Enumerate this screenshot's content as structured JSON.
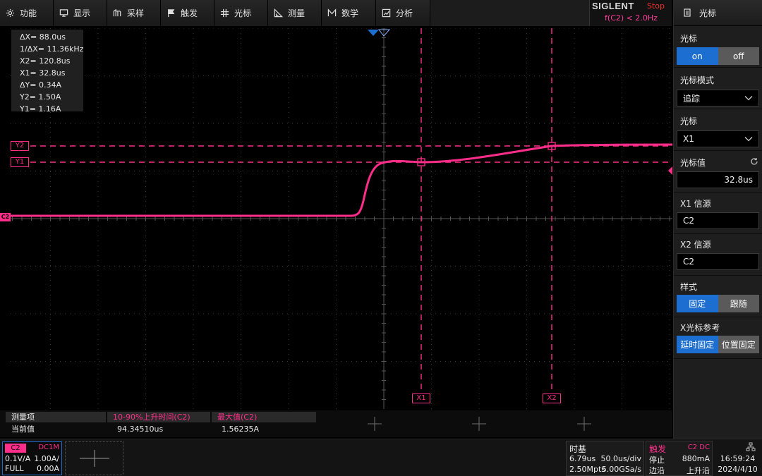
{
  "menu": [
    {
      "label": "功能",
      "icon": "gear-icon"
    },
    {
      "label": "显示",
      "icon": "monitor-icon"
    },
    {
      "label": "采样",
      "icon": "acquire-icon"
    },
    {
      "label": "触发",
      "icon": "trigger-flag-icon"
    },
    {
      "label": "光标",
      "icon": "cursor-cross-icon"
    },
    {
      "label": "测量",
      "icon": "ruler-icon"
    },
    {
      "label": "数学",
      "icon": "math-icon"
    },
    {
      "label": "分析",
      "icon": "analysis-icon"
    }
  ],
  "brand": "SIGLENT",
  "run_state": "Stop",
  "freq_readout": "f(C2) < 2.0Hz",
  "cursor_readout": [
    "ΔX= 88.0us",
    "1/ΔX= 11.36kHz",
    "X2= 120.8us",
    "X1= 32.8us",
    "ΔY= 0.34A",
    "Y2= 1.50A",
    "Y1= 1.16A"
  ],
  "cursor_tags": {
    "y2": "Y2",
    "y1": "Y1",
    "x1": "X1",
    "x2": "X2"
  },
  "channel_marker": "C2",
  "waveform": {
    "color": "#ff2d8a",
    "channel": "C2"
  },
  "panel": {
    "title": "光标",
    "cursor_label": "光标",
    "cursor_on": "on",
    "cursor_off": "off",
    "mode_label": "光标模式",
    "mode_value": "追踪",
    "select_label": "光标",
    "select_value": "X1",
    "value_label": "光标值",
    "value": "32.8us",
    "x1_src_label": "X1 信源",
    "x1_src": "C2",
    "x2_src_label": "X2 信源",
    "x2_src": "C2",
    "style_label": "样式",
    "style_fixed": "固定",
    "style_follow": "跟随",
    "xref_label": "X光标参考",
    "xref_delay": "延时固定",
    "xref_pos": "位置固定"
  },
  "measure": {
    "header_label": "测量项",
    "row_label": "当前值",
    "items": [
      {
        "name": "10-90%上升时间(C2)",
        "value": "94.34510us"
      },
      {
        "name": "最大值(C2)",
        "value": "1.56235A"
      }
    ]
  },
  "channel2": {
    "tag": "C2",
    "coupling": "DC1M",
    "scale": "0.1V/A",
    "vdiv": "1.00A/",
    "bw": "FULL",
    "offset": "0.00A"
  },
  "timebase": {
    "title": "时基",
    "delay": "6.79us",
    "tdiv": "50.0us/div",
    "points": "2.50Mpts",
    "srate": "5.00GSa/s"
  },
  "trigger": {
    "title": "触发",
    "source": "C2 DC",
    "state": "停止",
    "level": "880mA",
    "type": "边沿",
    "slope": "上升沿"
  },
  "clock": {
    "time": "16:59:24",
    "date": "2024/4/10"
  }
}
